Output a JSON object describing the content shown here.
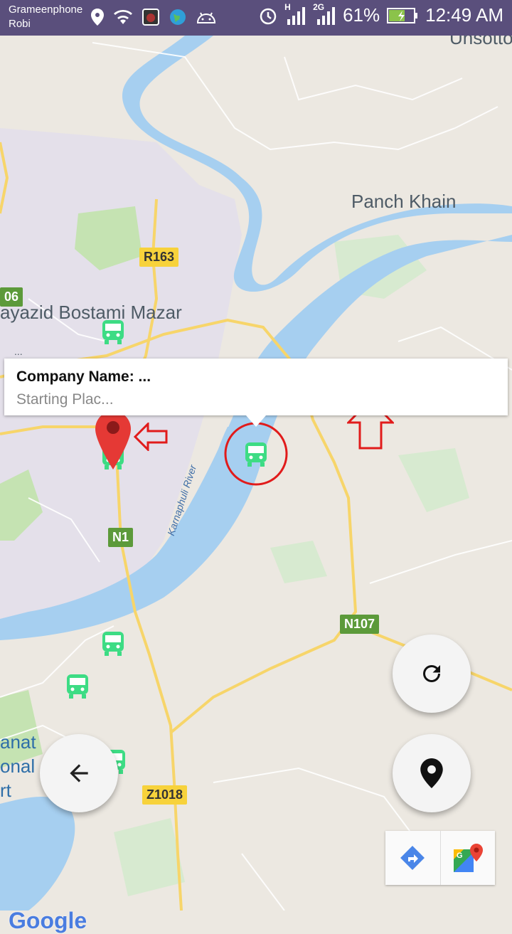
{
  "status_bar": {
    "carrier_1": "Grameenphone",
    "carrier_2": "Robi",
    "network_h": "H",
    "network_2g": "2G",
    "battery": "61%",
    "time": "12:49 AM"
  },
  "map": {
    "labels": {
      "panch_khain": "Panch Khain",
      "bayazid": "ayazid Bostami Mazar",
      "unsotto": "Unsotto",
      "national_park_1": "anat",
      "national_park_2": "onal",
      "national_park_3": "rt",
      "left_06": "06",
      "dots": "...",
      "river": "Karnaphuli River"
    },
    "roads": {
      "r163": "R163",
      "n1": "N1",
      "n107": "N107",
      "z1018": "Z1018"
    },
    "brand": "Google",
    "colors": {
      "water": "#a6cff0",
      "land": "#ece8e1",
      "park": "#c5e3b2",
      "urban": "#e4e0ea",
      "road": "#f7d56a",
      "bus": "#3ddc84",
      "marker": "#e53935",
      "annotation": "#e11b1b"
    }
  },
  "info_window": {
    "title": "Company Name: ...",
    "subtitle": "Starting Plac..."
  },
  "buttons": {
    "refresh": "refresh-icon",
    "location": "location-pin-icon",
    "back": "arrow-back-icon",
    "directions": "directions-icon",
    "open_maps": "google-maps-icon"
  }
}
